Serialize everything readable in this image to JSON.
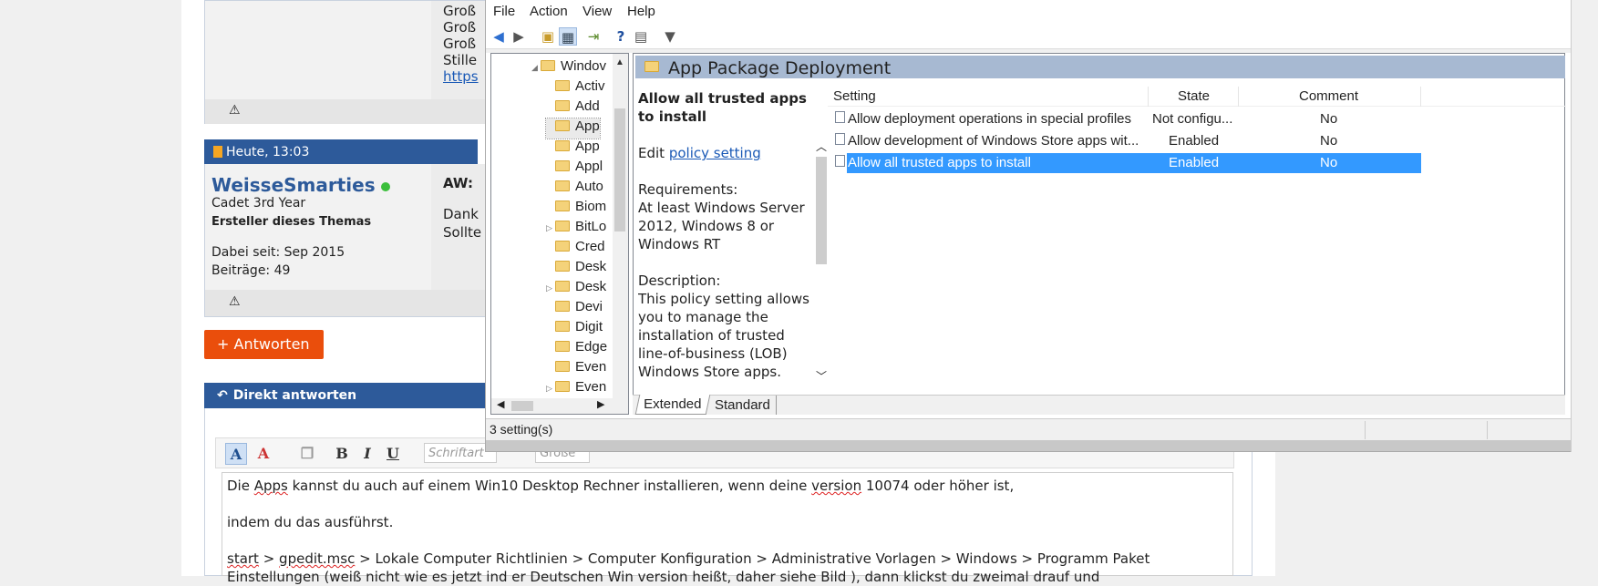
{
  "forum": {
    "post1_lines": [
      "Groß",
      "Groß",
      "Groß",
      "Stille",
      "https"
    ],
    "post2": {
      "timestamp": "Heute, 13:03",
      "username": "WeisseSmarties",
      "rank": "Cadet 3rd Year",
      "role": "Ersteller dieses Themas",
      "joined": "Dabei seit: Sep 2015",
      "posts": "Beiträge: 49",
      "title_prefix": "AW:",
      "body_lines": [
        "Dank",
        "Sollte"
      ]
    },
    "reply_button": "+ Antworten",
    "direct_reply_title": "Direkt antworten",
    "editor": {
      "font_placeholder": "Schriftart",
      "size_placeholder": "Größe",
      "line1_a": "Die ",
      "line1_apps": "Apps",
      "line1_b": " kannst du auch auf einem Win10 Desktop Rechner installieren, wenn deine ",
      "line1_version": "version",
      "line1_c": " 10074 oder höher ist,",
      "line2": "indem du das ausführst.",
      "line3_start": "start",
      "line3_gp": "gpedit.msc",
      "line3_rest": " > Lokale Computer Richtlinien > Computer Konfiguration > Administrative Vorlagen > Windows > Programm Paket",
      "line4": "Einstellungen (weiß nicht wie es jetzt ind er Deutschen Win version heißt, daher siehe Bild ), dann klickst du zweimal drauf und"
    }
  },
  "mmc": {
    "menu": [
      "File",
      "Action",
      "View",
      "Help"
    ],
    "tree": {
      "root": "Windov",
      "items": [
        "Activ",
        "Add",
        "App",
        "App",
        "Appl",
        "Auto",
        "Biom",
        "BitLo",
        "Cred",
        "Desk",
        "Desk",
        "Devi",
        "Digit",
        "Edge",
        "Even",
        "Even"
      ],
      "expandable": [
        false,
        false,
        false,
        false,
        false,
        false,
        false,
        true,
        false,
        false,
        true,
        false,
        false,
        false,
        false,
        true
      ],
      "selected_index": 2
    },
    "header_title": "App Package Deployment",
    "description": {
      "title": "Allow all trusted apps to install",
      "edit_prefix": "Edit ",
      "edit_link": "policy setting ",
      "requirements_label": "Requirements:",
      "requirements": "At least Windows Server 2012, Windows 8 or Windows RT",
      "description_label": "Description:",
      "description": "This policy setting allows you to manage the installation of trusted line-of-business (LOB) Windows Store apps."
    },
    "columns": {
      "setting": "Setting",
      "state": "State",
      "comment": "Comment"
    },
    "rows": [
      {
        "setting": "Allow deployment operations in special profiles",
        "state": "Not configu...",
        "comment": "No"
      },
      {
        "setting": "Allow development of Windows Store apps wit...",
        "state": "Enabled",
        "comment": "No"
      },
      {
        "setting": "Allow all trusted apps to install",
        "state": "Enabled",
        "comment": "No"
      }
    ],
    "selected_row": 2,
    "tabs": [
      "Extended",
      "Standard"
    ],
    "status": "3 setting(s)",
    "accent": "#3399ff"
  }
}
